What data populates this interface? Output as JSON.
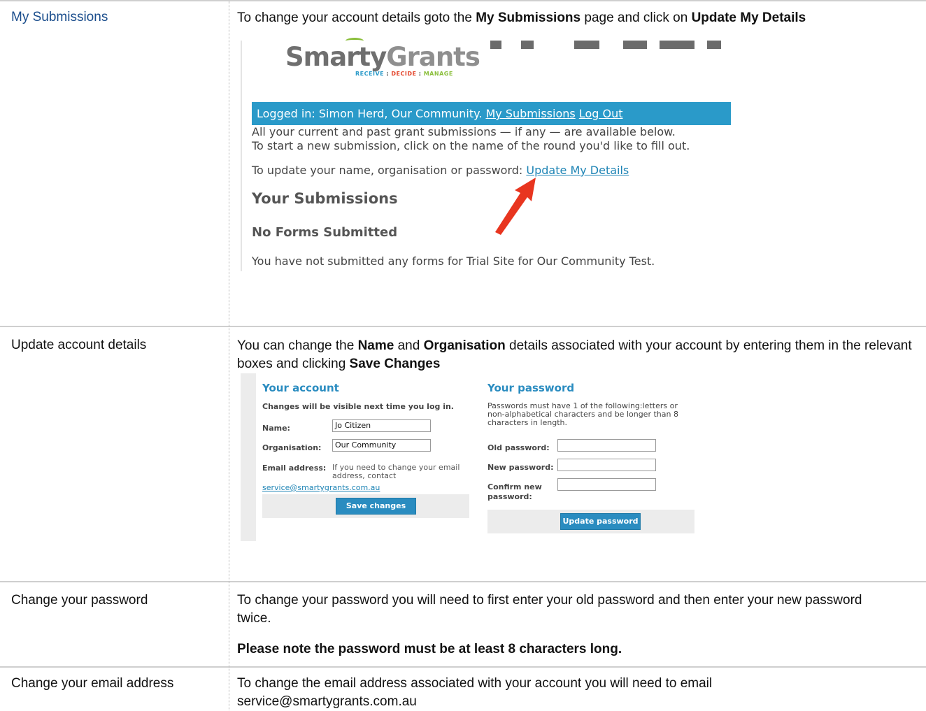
{
  "rows": [
    {
      "label": "My Submissions",
      "intro_prefix": "To change your account details goto the ",
      "intro_bold1": "My Submissions",
      "intro_mid": " page and click on ",
      "intro_bold2": "Update My Details"
    },
    {
      "label": "Update account details",
      "intro_prefix": "You can change the ",
      "intro_bold1": "Name",
      "intro_mid1": " and ",
      "intro_bold2": "Organisation",
      "intro_mid2": " details associated with your account by entering them in the relevant boxes and clicking ",
      "intro_bold3": "Save Changes"
    },
    {
      "label": "Change your password",
      "text": "To change your password you will need to first enter your old password and then enter your new password twice.",
      "note": "Please note the password must be at least 8 characters long."
    },
    {
      "label": "Change your email address",
      "text": "To change the email address associated with your account you will need to email service@smartygrants.com.au"
    }
  ],
  "screenshot_submissions": {
    "logo": "SmartyGrants",
    "logo_word1": "Smarty",
    "logo_word2": "Grants",
    "tagline_1": "RECEIVE",
    "tagline_sep": " : ",
    "tagline_2": "DECIDE",
    "tagline_3": "MANAGE",
    "login_text": "Logged in: Simon Herd, Our Community.",
    "my_submissions_link": "My Submissions",
    "logout_link": "Log Out",
    "line1": "All your current and past grant submissions — if any — are available below.",
    "line2": "To start a new submission, click on the name of the round you'd like to fill out.",
    "update_prefix": "To update your name, organisation or password:",
    "update_link": "Update My Details",
    "heading1": "Your Submissions",
    "heading2": "No Forms Submitted",
    "empty_text": "You have not submitted any forms for Trial Site for Our Community Test."
  },
  "screenshot_account": {
    "account_title": "Your account",
    "account_note": "Changes will be visible next time you log in.",
    "name_label": "Name:",
    "name_value": "Jo Citizen",
    "org_label": "Organisation:",
    "org_value": "Our Community",
    "email_label": "Email address:",
    "email_note": "If you need to change your email address, contact",
    "email_link": "service@smartygrants.com.au",
    "save_button": "Save changes",
    "password_title": "Your password",
    "password_rules": "Passwords must have 1 of the following:letters or non-alphabetical characters and be longer than 8 characters in length.",
    "old_label": "Old password:",
    "new_label": "New password:",
    "confirm_label": "Confirm new password:",
    "update_button": "Update password"
  },
  "colors": {
    "accent": "#2a9ac9",
    "link": "#1a4d8c",
    "arrow": "#e8351f"
  }
}
